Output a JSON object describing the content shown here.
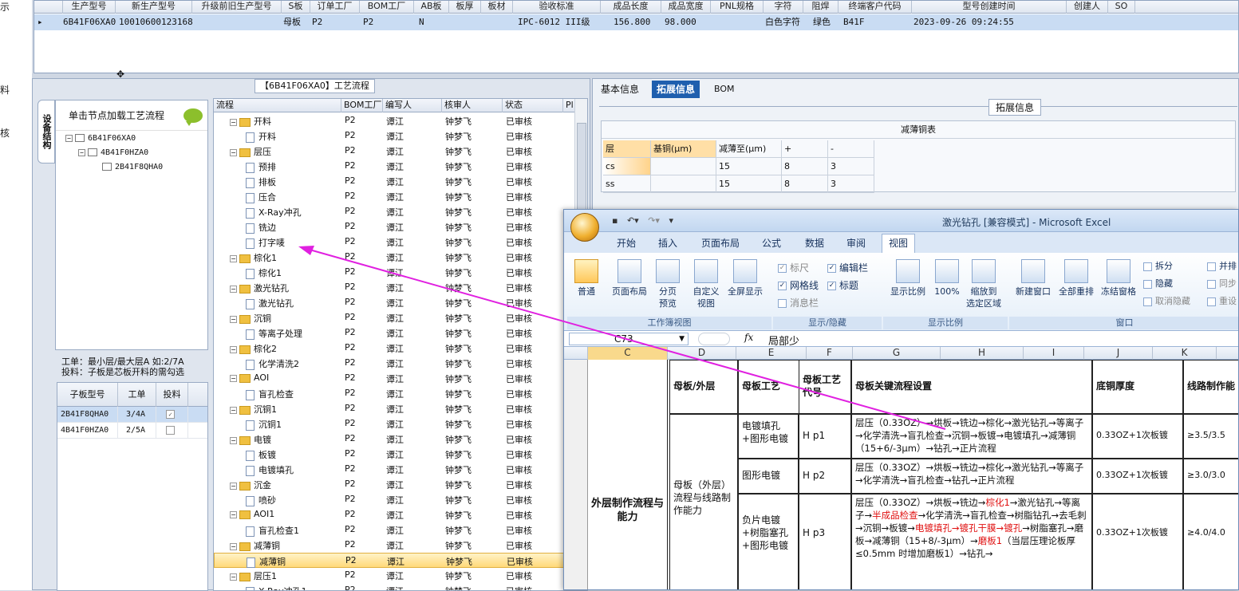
{
  "left_strip": [
    "示",
    "料",
    "核"
  ],
  "top_grid": {
    "headers": [
      "生产型号",
      "新生产型号",
      "升级前旧生产型号",
      "S板",
      "订单工厂",
      "BOM工厂",
      "AB板",
      "板厚",
      "板材",
      "验收标准",
      "成品长度",
      "成品宽度",
      "PNL规格",
      "字符",
      "阻焊",
      "终端客户代码",
      "型号创建时间",
      "创建人",
      "SO"
    ],
    "row": [
      "6B41F06XA0",
      "10010600123168",
      "",
      "母板",
      "P2",
      "P2",
      "N",
      "",
      "",
      "IPC-6012 III级",
      "156.800",
      "98.000",
      "",
      "白色字符",
      "绿色",
      "B41F",
      "2023-09-26 09:24:55",
      "",
      ""
    ]
  },
  "process_panel": {
    "title": "【6B41F06XA0】工艺流程",
    "side_tab": "设备结构",
    "tree_head": "单击节点加载工艺流程",
    "tree_nodes": [
      "6B41F06XA0",
      "4B41F0HZA0",
      "2B41F8QHA0"
    ],
    "info_line1": "工单：最小层/最大层A 如:2/7A",
    "info_line2": "投料：子板是芯板开料的需勾选",
    "sub_headers": [
      "子板型号",
      "工单",
      "投料"
    ],
    "sub_rows": [
      {
        "model": "2B41F8QHA0",
        "order": "3/4A",
        "checked": true
      },
      {
        "model": "4B41F0HZA0",
        "order": "2/5A",
        "checked": false
      }
    ]
  },
  "process_table": {
    "headers": [
      "流程",
      "BOM工厂",
      "编写人",
      "核审人",
      "状态",
      "Pl"
    ],
    "rows": [
      {
        "name": "开料",
        "type": "folder",
        "level": 1
      },
      {
        "name": "开料",
        "type": "file",
        "level": 2
      },
      {
        "name": "层压",
        "type": "folder",
        "level": 1
      },
      {
        "name": "预排",
        "type": "file",
        "level": 2
      },
      {
        "name": "排板",
        "type": "file",
        "level": 2
      },
      {
        "name": "压合",
        "type": "file",
        "level": 2
      },
      {
        "name": "X-Ray冲孔",
        "type": "file",
        "level": 2
      },
      {
        "name": "铣边",
        "type": "file",
        "level": 2
      },
      {
        "name": "打字唛",
        "type": "file",
        "level": 2
      },
      {
        "name": "棕化1",
        "type": "folder",
        "level": 1
      },
      {
        "name": "棕化1",
        "type": "file",
        "level": 2
      },
      {
        "name": "激光钻孔",
        "type": "folder",
        "level": 1
      },
      {
        "name": "激光钻孔",
        "type": "file",
        "level": 2
      },
      {
        "name": "沉铜",
        "type": "folder",
        "level": 1
      },
      {
        "name": "等离子处理",
        "type": "file",
        "level": 2
      },
      {
        "name": "棕化2",
        "type": "folder",
        "level": 1
      },
      {
        "name": "化学清洗2",
        "type": "file",
        "level": 2
      },
      {
        "name": "AOI",
        "type": "folder",
        "level": 1
      },
      {
        "name": "盲孔检查",
        "type": "file",
        "level": 2
      },
      {
        "name": "沉铜1",
        "type": "folder",
        "level": 1
      },
      {
        "name": "沉铜1",
        "type": "file",
        "level": 2
      },
      {
        "name": "电镀",
        "type": "folder",
        "level": 1
      },
      {
        "name": "板镀",
        "type": "file",
        "level": 2
      },
      {
        "name": "电镀填孔",
        "type": "file",
        "level": 2
      },
      {
        "name": "沉金",
        "type": "folder",
        "level": 1
      },
      {
        "name": "喷砂",
        "type": "file",
        "level": 2
      },
      {
        "name": "AOI1",
        "type": "folder",
        "level": 1
      },
      {
        "name": "盲孔检查1",
        "type": "file",
        "level": 2
      },
      {
        "name": "减薄铜",
        "type": "folder",
        "level": 1
      },
      {
        "name": "减薄铜",
        "type": "file",
        "level": 2,
        "selected": true
      },
      {
        "name": "层压1",
        "type": "folder",
        "level": 1
      },
      {
        "name": "X-Ray冲孔1",
        "type": "file",
        "level": 2
      }
    ],
    "bom": "P2",
    "writer": "谭江",
    "auditor": "钟梦飞",
    "status": "已审核"
  },
  "right_panel": {
    "tabs": [
      "基本信息",
      "拓展信息",
      "BOM"
    ],
    "group_title": "拓展信息",
    "reduce_title": "减薄铜表",
    "reduce_headers": [
      "层",
      "基铜(μm)",
      "减薄至(μm)",
      "+",
      "-"
    ],
    "reduce_rows": [
      [
        "cs",
        "",
        "15",
        "8",
        "3"
      ],
      [
        "ss",
        "",
        "15",
        "8",
        "3"
      ]
    ]
  },
  "excel": {
    "title": "激光钻孔 [兼容模式] - Microsoft Excel",
    "tabs": [
      "开始",
      "插入",
      "页面布局",
      "公式",
      "数据",
      "审阅",
      "视图"
    ],
    "ribbon": {
      "views": [
        "普通",
        "页面布局",
        "分页\n预览",
        "自定义\n视图",
        "全屏显示"
      ],
      "views_group": "工作簿视图",
      "show_checks": [
        {
          "label": "标尺",
          "checked": true
        },
        {
          "label": "编辑栏",
          "checked": true
        },
        {
          "label": "网格线",
          "checked": true
        },
        {
          "label": "标题",
          "checked": true
        },
        {
          "label": "消息栏",
          "checked": false
        }
      ],
      "show_group": "显示/隐藏",
      "zoom": [
        "显示比例",
        "100%",
        "缩放到\n选定区域"
      ],
      "zoom_group": "显示比例",
      "window": [
        "新建窗口",
        "全部重排",
        "冻结窗格",
        "拆分",
        "隐藏",
        "取消隐藏",
        "并排",
        "同步",
        "重设"
      ],
      "window_group": "窗口"
    },
    "namebox": "C73",
    "formula": "局部少",
    "columns": [
      "C",
      "D",
      "E",
      "F",
      "G",
      "H",
      "I",
      "J",
      "K"
    ],
    "table": {
      "h1": "母板/外层",
      "h2": "母板工艺",
      "h3": "母板工艺代号",
      "h4": "母板关键流程设置",
      "h5": "底铜厚度",
      "h6": "线路制作能",
      "side_label": "外层制作流程与能力",
      "group_label": "母板（外层）流程与线路制作能力",
      "rows": [
        {
          "proc": "电镀填孔+图形电镀",
          "code": "H p1",
          "flow": "层压（0.33OZ）→烘板→铣边→棕化→激光钻孔→等离子→化学清洗→盲孔检查→沉铜→板镀→电镀填孔→减薄铜（15+6/-3μm）→钻孔→正片流程",
          "cu": "0.33OZ+1次板镀",
          "cap": "≥3.5/3.5"
        },
        {
          "proc": "图形电镀",
          "code": "H p2",
          "flow": "层压（0.33OZ）→烘板→铣边→棕化→激光钻孔→等离子→化学清洗→盲孔检查→钻孔→正片流程",
          "cu": "0.33OZ+1次板镀",
          "cap": "≥3.0/3.0"
        },
        {
          "proc": "负片电镀+树脂塞孔+图形电镀",
          "code": "H p3",
          "flow_a": "层压（0.33OZ）→烘板→铣边→",
          "flow_r1": "棕化1",
          "flow_b": "→激光钻孔→等离子→",
          "flow_r2": "半成品检查",
          "flow_c": "→化学清洗→盲孔检查→树脂钻孔→去毛刺→沉铜→板镀→",
          "flow_r3": "电镀填孔→镀孔干膜→镀孔",
          "flow_d": "→树脂塞孔→磨板→减薄铜（15+8/-3μm）→",
          "flow_r4": "磨板1",
          "flow_e": "（当层压理论板厚≤0.5mm 时增加磨板1）→钻孔→",
          "cu": "0.33OZ+1次板镀",
          "cap": "≥4.0/4.0"
        }
      ]
    }
  }
}
